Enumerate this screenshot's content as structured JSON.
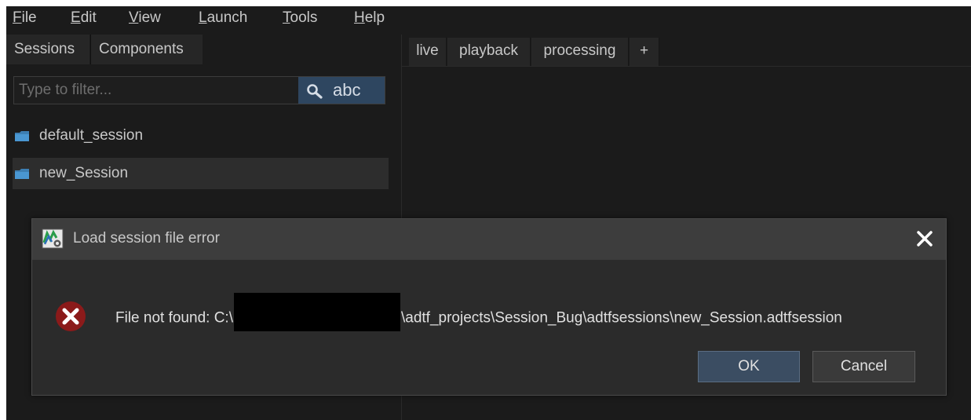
{
  "menubar": {
    "items": [
      {
        "mnemonic": "F",
        "rest": "ile"
      },
      {
        "mnemonic": "E",
        "rest": "dit"
      },
      {
        "mnemonic": "V",
        "rest": "iew"
      },
      {
        "mnemonic": "L",
        "rest": "aunch"
      },
      {
        "mnemonic": "T",
        "rest": "ools"
      },
      {
        "mnemonic": "H",
        "rest": "elp"
      }
    ]
  },
  "left_panel": {
    "tabs": [
      "Sessions",
      "Components"
    ],
    "filter": {
      "placeholder": "Type to filter...",
      "button_label": "abc",
      "button_icon": "search-icon"
    },
    "sessions": [
      {
        "label": "default_session",
        "icon": "folder-icon"
      },
      {
        "label": "new_Session",
        "icon": "folder-icon",
        "selected": true
      }
    ]
  },
  "right_panel": {
    "tabs": [
      "live",
      "playback",
      "processing",
      "+"
    ]
  },
  "dialog": {
    "title": "Load session file error",
    "message_prefix": "File not found: C:\\",
    "message_suffix": "\\adtf_projects\\Session_Bug\\adtfsessions\\new_Session.adtfsession",
    "ok_label": "OK",
    "cancel_label": "Cancel",
    "icons": {
      "title": "app-icon",
      "close": "close-icon",
      "error": "error-icon"
    }
  },
  "colors": {
    "background": "#1b1b1b",
    "panel": "#262626",
    "dialog": "#2b2b2b",
    "dialog_title": "#3d3d3d",
    "accent": "#2e4660",
    "error_red": "#8b1a1a"
  }
}
